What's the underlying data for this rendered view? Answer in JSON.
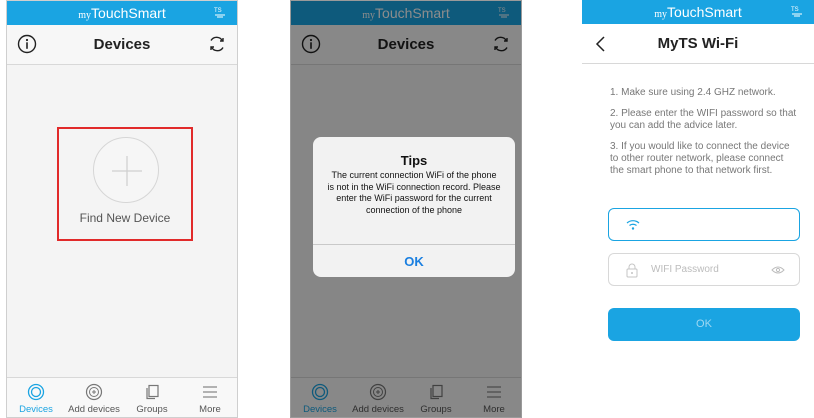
{
  "status_bar": {
    "brand_prefix": "my",
    "brand_name": "TouchSmart",
    "logo_icon": "mts-logo-icon"
  },
  "colors": {
    "accent": "#1aa4e2",
    "highlight_border": "#e12a2a",
    "dialog_button": "#1a7fe0"
  },
  "screen1": {
    "nav_title": "Devices",
    "find_new_device_label": "Find New Device"
  },
  "tabbar": {
    "items": [
      {
        "label": "Devices",
        "icon": "target-icon",
        "active": true
      },
      {
        "label": "Add devices",
        "icon": "plus-circle-icon",
        "active": false
      },
      {
        "label": "Groups",
        "icon": "stack-icon",
        "active": false
      },
      {
        "label": "More",
        "icon": "menu-icon",
        "active": false
      }
    ]
  },
  "screen2": {
    "nav_title": "Devices",
    "dialog": {
      "title": "Tips",
      "message": "The current connection WiFi of the phone is not in the WiFi connection record. Please enter the WiFi password for the current connection of the phone",
      "ok_label": "OK"
    }
  },
  "screen3": {
    "nav_title": "MyTS Wi-Fi",
    "instructions": [
      "1. Make sure using 2.4 GHZ network.",
      "2. Please enter the WIFI password so that you can add the advice later.",
      "3. If you would like to connect the device to other router network, please connect the smart phone to that network first."
    ],
    "wifi_field_value": "",
    "password_placeholder": "WIFI Password",
    "ok_label": "OK"
  }
}
